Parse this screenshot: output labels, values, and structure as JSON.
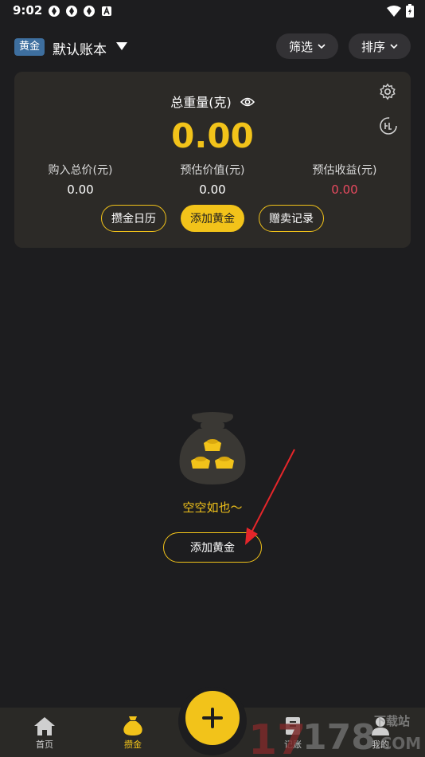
{
  "status_bar": {
    "time": "9:02"
  },
  "header": {
    "badge": "黄金",
    "account_name": "默认账本",
    "filter_label": "筛选",
    "sort_label": "排序"
  },
  "summary": {
    "total_weight_label": "总重量(克)",
    "total_weight_value": "0.00",
    "stats": [
      {
        "label": "购入总价(元)",
        "value": "0.00"
      },
      {
        "label": "预估价值(元)",
        "value": "0.00"
      },
      {
        "label": "预估收益(元)",
        "value": "0.00"
      }
    ],
    "buttons": {
      "calendar": "攒金日历",
      "add_gold": "添加黄金",
      "gift_sale": "赠卖记录"
    }
  },
  "empty_state": {
    "message": "空空如也～",
    "add_button": "添加黄金"
  },
  "bottom_nav": {
    "items": [
      {
        "label": "首页",
        "icon": "home-icon"
      },
      {
        "label": "攒金",
        "icon": "money-bag-icon"
      },
      {
        "label": "记账",
        "icon": "ledger-icon"
      },
      {
        "label": "我的",
        "icon": "user-icon"
      }
    ]
  },
  "watermark": {
    "text_1": "17",
    "text_2": "178",
    "text_3": "下载站",
    "text_4": ".COM"
  },
  "colors": {
    "accent": "#f2c31a",
    "background": "#1d1d1f",
    "card": "#2c2a27",
    "negative": "#e84a5f",
    "badge": "#3e6f9f"
  }
}
